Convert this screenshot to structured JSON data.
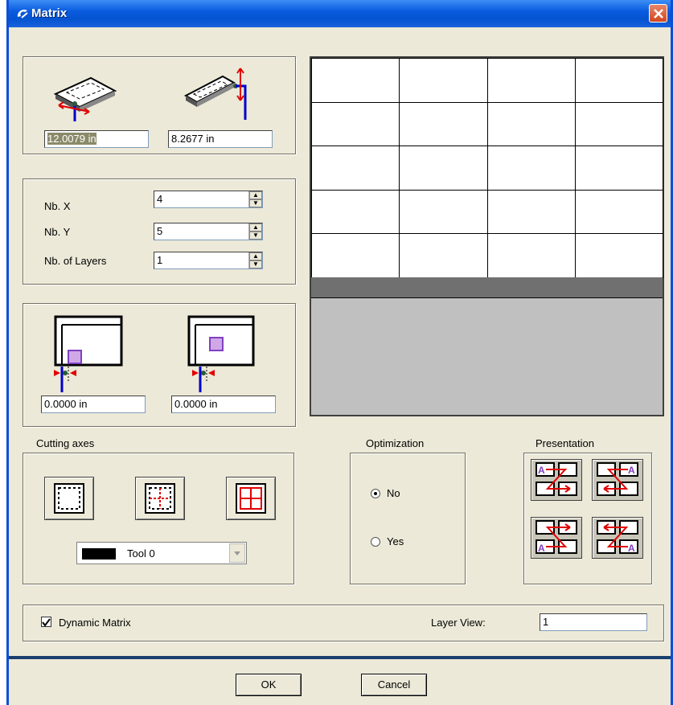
{
  "window": {
    "title": "Matrix"
  },
  "size": {
    "width_value": "12.0079 in",
    "height_value": "8.2677 in"
  },
  "counts": {
    "nb_x_label": "Nb. X",
    "nb_x_value": "4",
    "nb_y_label": "Nb. Y",
    "nb_y_value": "5",
    "layers_label": "Nb. of Layers",
    "layers_value": "1"
  },
  "offsets": {
    "left_value": "0.0000 in",
    "right_value": "0.0000 in"
  },
  "cutting_axes": {
    "title": "Cutting axes",
    "tool_label": "Tool 0",
    "tool_color": "#000000"
  },
  "optimization": {
    "title": "Optimization",
    "no_label": "No",
    "yes_label": "Yes",
    "selected": "No"
  },
  "presentation": {
    "title": "Presentation"
  },
  "footer": {
    "dynamic_matrix_label": "Dynamic Matrix",
    "dynamic_matrix_checked": true,
    "layer_view_label": "Layer View:",
    "layer_view_value": "1"
  },
  "buttons": {
    "ok_label": "OK",
    "cancel_label": "Cancel"
  },
  "colors": {
    "title_bar": "#0a5ce0",
    "accent_red": "#e00000",
    "accent_blue": "#0000cc",
    "accent_purple": "#8040c0"
  }
}
